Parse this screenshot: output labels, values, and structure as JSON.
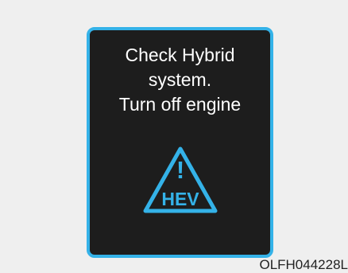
{
  "display": {
    "message_lines": [
      "Check Hybrid",
      "system.",
      "Turn off engine"
    ],
    "frame_color": "#34b2e8",
    "background_color": "#1d1d1d",
    "text_color": "#ffffff"
  },
  "icon": {
    "name": "hev-warning-icon",
    "label": "HEV",
    "symbol": "!",
    "color": "#34b2e8"
  },
  "footer": {
    "code": "OLFH044228L"
  }
}
